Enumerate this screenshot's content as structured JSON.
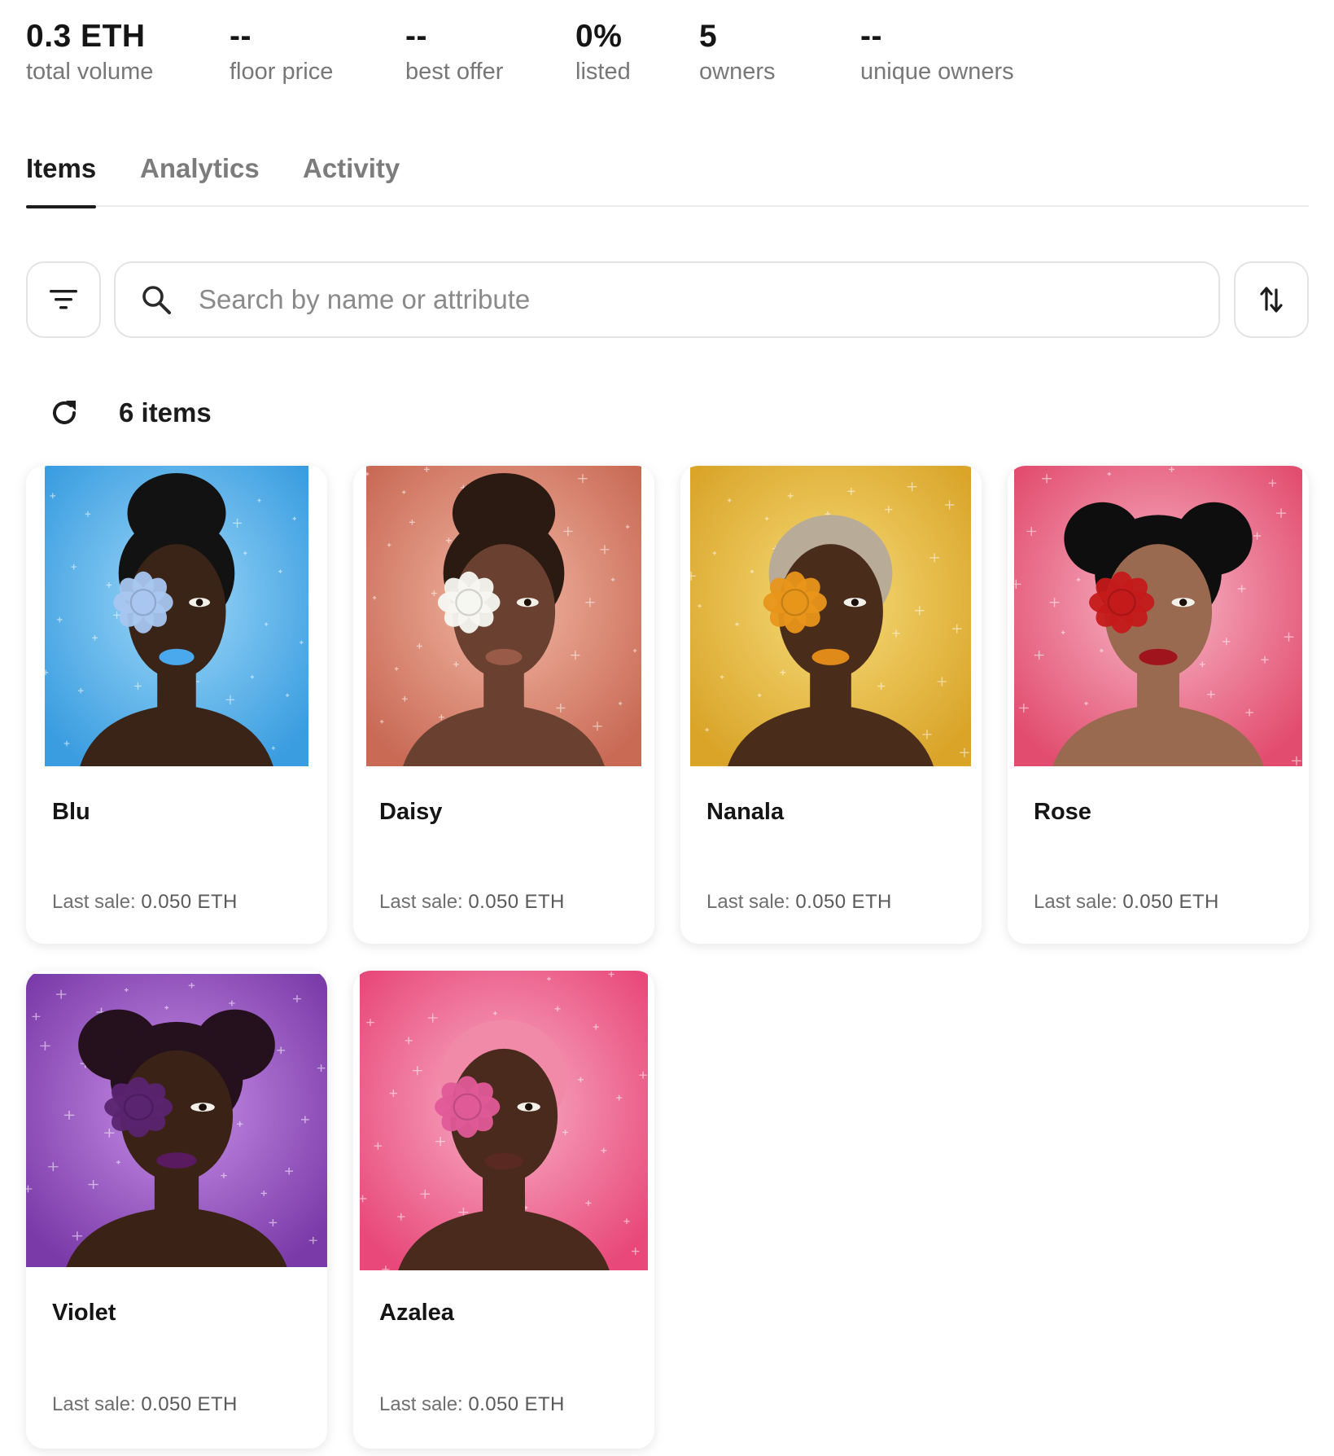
{
  "stats": [
    {
      "value": "0.3 ETH",
      "label": "total volume"
    },
    {
      "value": "--",
      "label": "floor price"
    },
    {
      "value": "--",
      "label": "best offer"
    },
    {
      "value": "0%",
      "label": "listed"
    },
    {
      "value": "5",
      "label": "owners"
    },
    {
      "value": "--",
      "label": "unique owners"
    }
  ],
  "tabs": [
    {
      "label": "Items",
      "active": true
    },
    {
      "label": "Analytics",
      "active": false
    },
    {
      "label": "Activity",
      "active": false
    }
  ],
  "toolbar": {
    "filter_icon": "filter-icon",
    "search_icon": "search-icon",
    "search_placeholder": "Search by name or attribute",
    "search_value": "",
    "sort_icon": "sort-arrows-icon"
  },
  "results": {
    "refresh_icon": "refresh-icon",
    "count_label": "6 items"
  },
  "items": [
    {
      "name": "Blu",
      "last_sale_label": "Last sale:",
      "last_sale_value": "0.050 ETH",
      "bg": "#3a9de0",
      "bg2": "#9ed8f8",
      "skin": "#3a2418",
      "hair": "#121212",
      "flower": "#a8c6f0",
      "lips": "#4aa8ec"
    },
    {
      "name": "Daisy",
      "last_sale_label": "Last sale:",
      "last_sale_value": "0.050 ETH",
      "bg": "#c96a55",
      "bg2": "#f2b9a6",
      "skin": "#6a4030",
      "hair": "#2a1a12",
      "flower": "#f7f7f2",
      "lips": "#9a5a48"
    },
    {
      "name": "Nanala",
      "last_sale_label": "Last sale:",
      "last_sale_value": "0.050 ETH",
      "bg": "#d9a428",
      "bg2": "#f7dc7a",
      "skin": "#4a2c1a",
      "hair": "#b8ab98",
      "flower": "#e8961a",
      "lips": "#e08a1a"
    },
    {
      "name": "Rose",
      "last_sale_label": "Last sale:",
      "last_sale_value": "0.050 ETH",
      "bg": "#e24c6e",
      "bg2": "#f7b8c8",
      "skin": "#9a6a50",
      "hair": "#0e0e0e",
      "flower": "#c41a1a",
      "lips": "#a0141e"
    },
    {
      "name": "Violet",
      "last_sale_label": "Last sale:",
      "last_sale_value": "0.050 ETH",
      "bg": "#7a3aa8",
      "bg2": "#c890e8",
      "skin": "#3a2216",
      "hair": "#25101e",
      "flower": "#5a2470",
      "lips": "#5a1a60"
    },
    {
      "name": "Azalea",
      "last_sale_label": "Last sale:",
      "last_sale_value": "0.050 ETH",
      "bg": "#e8487a",
      "bg2": "#f8b0c8",
      "skin": "#4a2a1c",
      "hair": "#f08aa8",
      "flower": "#e05a98",
      "lips": "#5a2a22"
    }
  ]
}
